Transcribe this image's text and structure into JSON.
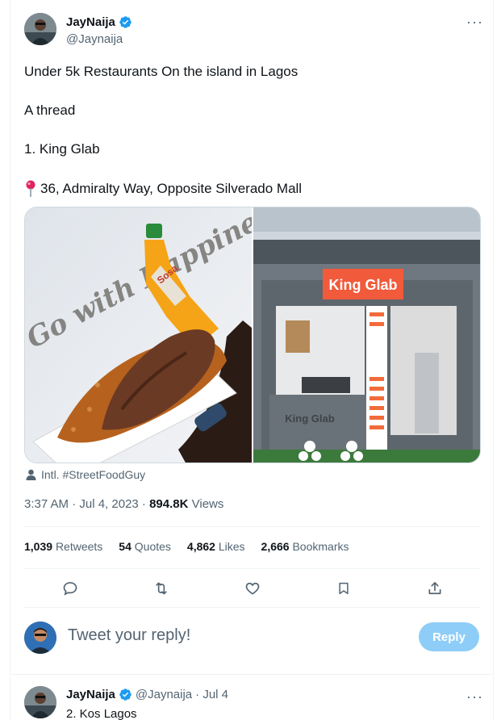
{
  "tweet": {
    "author": {
      "name": "JayNaija",
      "handle": "@Jaynaija",
      "verified": true,
      "avatar_icon": "profile-avatar-icon"
    },
    "more_icon": "more-dots-icon",
    "text_lines": [
      "Under 5k Restaurants On the island in Lagos",
      "A thread",
      "1. King Glab",
      "36, Admiralty Way, Opposite Silverado Mall"
    ],
    "location_icon": "red-pin-icon",
    "media": {
      "image1": {
        "watermark": "Go with Happiness.",
        "bottle_label": "Sosa"
      },
      "image2": {
        "store_sign": "King Glab",
        "window_text": "King Glab"
      }
    },
    "attribution": "Intl. #StreetFoodGuy",
    "timestamp": "3:37 AM · Jul 4, 2023 · ",
    "views_count": "894.8K",
    "views_label": " Views",
    "stats": [
      {
        "count": "1,039",
        "label": "Retweets"
      },
      {
        "count": "54",
        "label": "Quotes"
      },
      {
        "count": "4,862",
        "label": "Likes"
      },
      {
        "count": "2,666",
        "label": "Bookmarks"
      }
    ],
    "actions": [
      "reply-icon",
      "retweet-icon",
      "like-icon",
      "bookmark-icon",
      "share-icon"
    ]
  },
  "reply_box": {
    "placeholder": "Tweet your reply!",
    "button_label": "Reply"
  },
  "next_tweet": {
    "name": "JayNaija",
    "handle": "@Jaynaija",
    "date": " · Jul 4",
    "text": "2. Kos Lagos"
  },
  "colors": {
    "accent": "#1d9bf0",
    "reply_button_disabled": "#8ecdf7",
    "sign": "#f15a3a",
    "pin": "#e0245e"
  }
}
